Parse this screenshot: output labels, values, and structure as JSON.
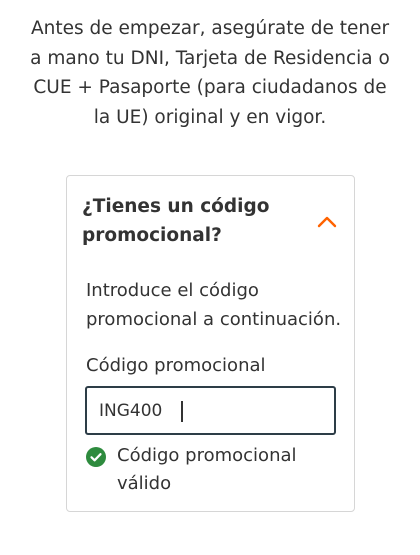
{
  "intro_text": "Antes de empezar, asegúrate de tener a mano tu DNI, Tarjeta de Residencia o CUE + Pasaporte (para ciudadanos de la UE) original y en vigor.",
  "promo_card": {
    "title": "¿Tienes un código promocional?",
    "toggle_icon": "chevron-up-icon",
    "description": "Introduce el código promocional a continuación.",
    "field_label": "Código promocional",
    "field_value": "ING400",
    "validation_icon": "check-circle-icon",
    "validation_message": "Código promocional válido"
  },
  "colors": {
    "accent": "#ff6200",
    "success": "#2e8b3e",
    "input_border": "#2d3d47",
    "text": "#333333"
  }
}
